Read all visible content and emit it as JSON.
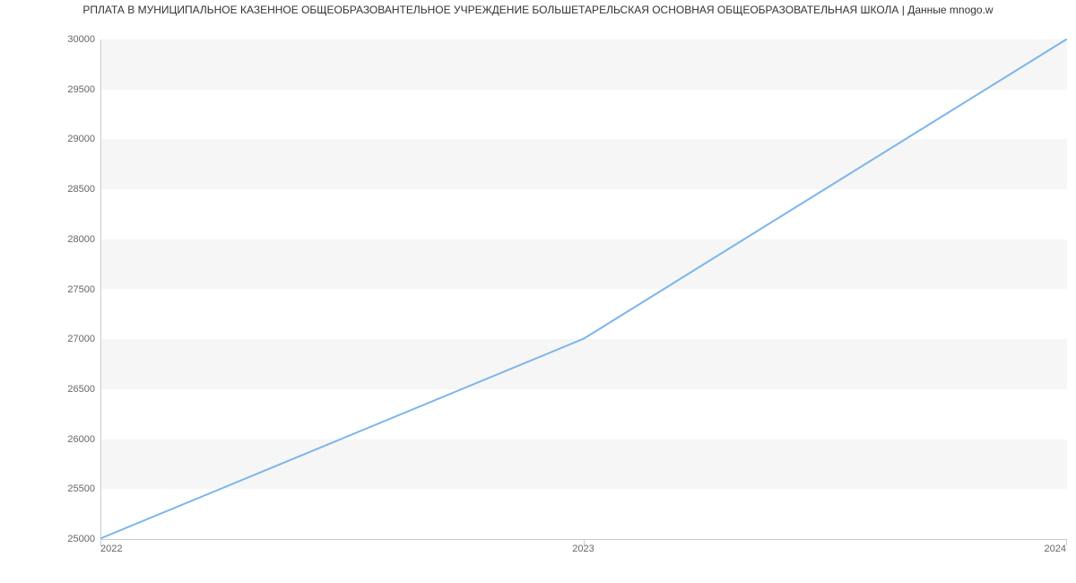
{
  "chart_data": {
    "type": "line",
    "title": "РПЛАТА В МУНИЦИПАЛЬНОЕ КАЗЕННОЕ ОБЩЕОБРАЗОВАНТЕЛЬНОЕ УЧРЕЖДЕНИЕ БОЛЬШЕТАРЕЛЬСКАЯ ОСНОВНАЯ ОБЩЕОБРАЗОВАТЕЛЬНАЯ ШКОЛА | Данные mnogo.w",
    "x": [
      2022,
      2023,
      2024
    ],
    "values": [
      25000,
      27000,
      30000
    ],
    "x_tick_labels": [
      "2022",
      "2023",
      "2024"
    ],
    "y_ticks": [
      25000,
      25500,
      26000,
      26500,
      27000,
      27500,
      28000,
      28500,
      29000,
      29500,
      30000
    ],
    "y_tick_labels": [
      "25000",
      "25500",
      "26000",
      "26500",
      "27000",
      "27500",
      "28000",
      "28500",
      "29000",
      "29500",
      "30000"
    ],
    "xlim": [
      2022,
      2024
    ],
    "ylim": [
      25000,
      30000
    ],
    "line_color": "#7cb5ec",
    "band_color": "#f6f6f6"
  }
}
